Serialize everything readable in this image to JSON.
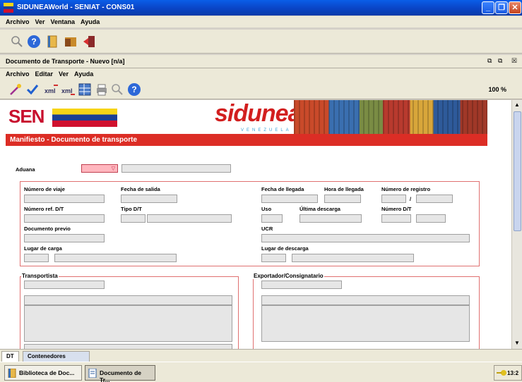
{
  "window": {
    "title": "SIDUNEAWorld - SENIAT - CONS01",
    "colors": {
      "titlebar": "#0a46c8",
      "accent_red": "#dc2d25",
      "required_field": "#ffb6be"
    }
  },
  "main_menu": [
    "Archivo",
    "Ver",
    "Ventana",
    "Ayuda"
  ],
  "main_toolbar": {
    "icons": [
      "search-icon",
      "help-icon",
      "book-icon",
      "folder-icon",
      "exit-icon"
    ]
  },
  "document_window": {
    "title": "Documento de Transporte - Nuevo [n/a]",
    "menu": [
      "Archivo",
      "Editar",
      "Ver",
      "Ayuda"
    ],
    "toolbar_icons": [
      "wand-icon",
      "check-icon",
      "xml-export-icon",
      "xml-import-icon",
      "grid-icon",
      "print-icon",
      "search-icon",
      "help-icon"
    ],
    "zoom": "100 %"
  },
  "banner": {
    "seniat_logo": "SENIAT",
    "sidunea_logo": "sidunea",
    "sidunea_subtitle": "VENEZUELA"
  },
  "form": {
    "section_title": "Manifiesto - Documento de transporte",
    "aduana_label": "Aduana",
    "labels": {
      "numero_viaje": "Número de viaje",
      "fecha_salida": "Fecha de salida",
      "fecha_llegada": "Fecha de llegada",
      "hora_llegada": "Hora de llegada",
      "numero_registro": "Número de registro",
      "numero_ref_dt": "Número ref. D/T",
      "tipo_dt": "Tipo D/T",
      "uso": "Uso",
      "ultima_descarga": "Última descarga",
      "numero_dt": "Número D/T",
      "documento_previo": "Documento previo",
      "ucr": "UCR",
      "lugar_carga": "Lugar de carga",
      "lugar_descarga": "Lugar de descarga"
    },
    "registro_separator": "/",
    "transportista_legend": "Transportista",
    "exportador_legend": "Exportador/Consignatario"
  },
  "tabs": [
    "DT",
    "Contenedores"
  ],
  "taskbar": {
    "tasks": [
      "Biblioteca de Doc...",
      "Documento de Tr..."
    ],
    "clock": "13:2"
  }
}
